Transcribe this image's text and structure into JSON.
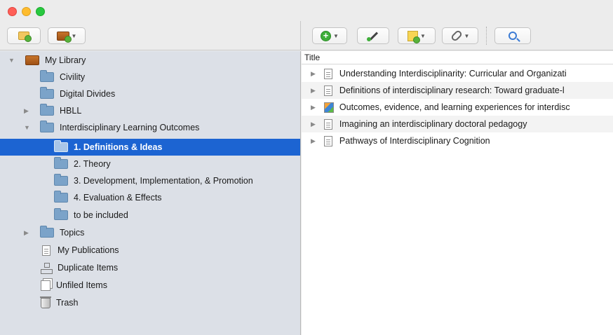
{
  "window": {
    "controls": [
      "close",
      "minimize",
      "zoom"
    ]
  },
  "toolbar_left": {
    "buttons": [
      {
        "icon": "new-collection-icon"
      },
      {
        "icon": "new-library-icon",
        "has_menu": true
      }
    ]
  },
  "toolbar_right": {
    "buttons": [
      {
        "icon": "new-item-icon",
        "has_menu": true
      },
      {
        "icon": "add-by-identifier-icon"
      },
      {
        "icon": "new-note-icon",
        "has_menu": true
      },
      {
        "icon": "attachment-icon",
        "has_menu": true
      },
      {
        "icon": "search-icon"
      }
    ]
  },
  "sidebar": {
    "items": [
      {
        "label": "My Library",
        "icon": "library-icon",
        "expanded": true
      },
      {
        "label": "Civility",
        "icon": "folder-icon"
      },
      {
        "label": "Digital Divides",
        "icon": "folder-icon"
      },
      {
        "label": "HBLL",
        "icon": "folder-icon",
        "expanded": false
      },
      {
        "label": "Interdisciplinary Learning Outcomes",
        "icon": "folder-icon",
        "expanded": true
      },
      {
        "label": "1. Definitions & Ideas",
        "icon": "folder-icon",
        "selected": true
      },
      {
        "label": "2. Theory",
        "icon": "folder-icon"
      },
      {
        "label": "3. Development, Implementation, & Promotion",
        "icon": "folder-icon"
      },
      {
        "label": "4. Evaluation & Effects",
        "icon": "folder-icon"
      },
      {
        "label": "to be included",
        "icon": "folder-icon"
      },
      {
        "label": "Topics",
        "icon": "folder-icon",
        "expanded": false
      },
      {
        "label": "My Publications",
        "icon": "document-icon"
      },
      {
        "label": "Duplicate Items",
        "icon": "duplicate-icon"
      },
      {
        "label": "Unfiled Items",
        "icon": "unfiled-icon"
      },
      {
        "label": "Trash",
        "icon": "trash-icon"
      }
    ]
  },
  "items_pane": {
    "column_header": "Title",
    "rows": [
      {
        "title": "Understanding Interdisciplinarity: Curricular and Organizati",
        "icon": "document-icon"
      },
      {
        "title": "Definitions of interdisciplinary research: Toward graduate-l",
        "icon": "document-icon"
      },
      {
        "title": "Outcomes, evidence, and learning experiences for interdisc",
        "icon": "webpage-icon"
      },
      {
        "title": "Imagining an interdisciplinary doctoral pedagogy",
        "icon": "document-icon"
      },
      {
        "title": "Pathways of Interdisciplinary Cognition",
        "icon": "document-icon"
      }
    ]
  },
  "colors": {
    "selection": "#1c64d2",
    "sidebar_bg": "#dce0e7",
    "folder": "#7ba3c9"
  }
}
